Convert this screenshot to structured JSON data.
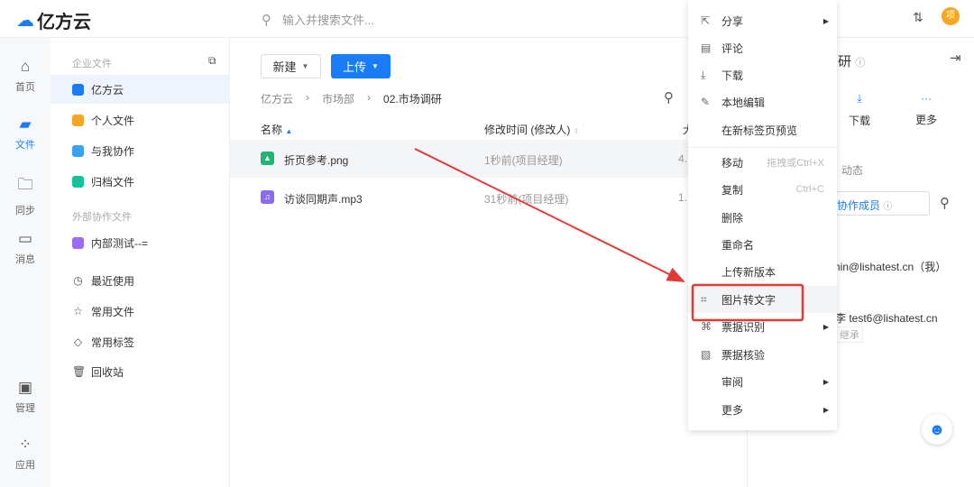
{
  "header": {
    "logo": "亿方云",
    "search_placeholder": "输入并搜索文件...",
    "avatar": "项"
  },
  "rail": [
    {
      "label": "首页",
      "icon": "home-icon"
    },
    {
      "label": "文件",
      "icon": "folder-icon"
    },
    {
      "label": "同步",
      "icon": "sync-icon"
    },
    {
      "label": "消息",
      "icon": "message-icon"
    },
    {
      "label": "管理",
      "icon": "admin-icon"
    },
    {
      "label": "应用",
      "icon": "apps-icon"
    }
  ],
  "sidebar": {
    "enterprise_heading": "企业文件",
    "external_heading": "外部协作文件",
    "items": [
      {
        "label": "亿方云",
        "color": "#1a7cf5"
      },
      {
        "label": "个人文件",
        "color": "#f5a623"
      },
      {
        "label": "与我协作",
        "color": "#3aa0f0"
      },
      {
        "label": "归档文件",
        "color": "#15c39a"
      }
    ],
    "external_items": [
      {
        "label": "内部测试--=",
        "color": "#9b6cf0"
      }
    ],
    "tools": [
      {
        "label": "最近使用",
        "icon": "clock-icon"
      },
      {
        "label": "常用文件",
        "icon": "star-icon"
      },
      {
        "label": "常用标签",
        "icon": "tag-icon"
      },
      {
        "label": "回收站",
        "icon": "trash-icon"
      }
    ]
  },
  "main": {
    "new_label": "新建",
    "upload_label": "上传",
    "breadcrumb": [
      "亿方云",
      "市场部",
      "02.市场调研"
    ],
    "columns": {
      "name": "名称",
      "modified": "修改时间 (修改人)",
      "size": "大"
    },
    "files": [
      {
        "name": "折页参考.png",
        "modified": "1秒前(项目经理)",
        "size": "4.",
        "color": "#1fb574"
      },
      {
        "name": "访谈同期声.mp3",
        "modified": "31秒前(项目经理)",
        "size": "1.",
        "color": "#8a6cf0"
      }
    ]
  },
  "menu": {
    "items": [
      {
        "label": "分享",
        "icon": "share-icon",
        "submenu": true
      },
      {
        "label": "评论",
        "icon": "comment-icon"
      },
      {
        "label": "下载",
        "icon": "download-icon"
      },
      {
        "label": "本地编辑",
        "icon": "edit-icon"
      },
      {
        "label": "在新标签页预览"
      },
      {
        "label": "移动",
        "shortcut": "拖拽或Ctrl+X"
      },
      {
        "label": "复制",
        "shortcut": "Ctrl+C"
      },
      {
        "label": "删除"
      },
      {
        "label": "重命名"
      },
      {
        "label": "上传新版本"
      },
      {
        "label": "图片转文字",
        "icon": "ocr-icon",
        "highlighted": true
      },
      {
        "label": "票据识别",
        "icon": "scan-icon",
        "submenu": true
      },
      {
        "label": "票据核验",
        "icon": "verify-icon"
      },
      {
        "label": "审阅",
        "submenu": true
      },
      {
        "label": "更多",
        "submenu": true
      }
    ]
  },
  "right_panel": {
    "title_fragment": "研",
    "download": "下载",
    "more": "更多",
    "tab_activity": "动态",
    "invite_fragment": "协作成员",
    "member1": "dmin@lishatest.cn（我）",
    "member2": "李 test6@lishatest.cn",
    "inherit_tag": "继承"
  },
  "colors": {
    "accent": "#1a7cf5",
    "annotation": "#e53935"
  }
}
